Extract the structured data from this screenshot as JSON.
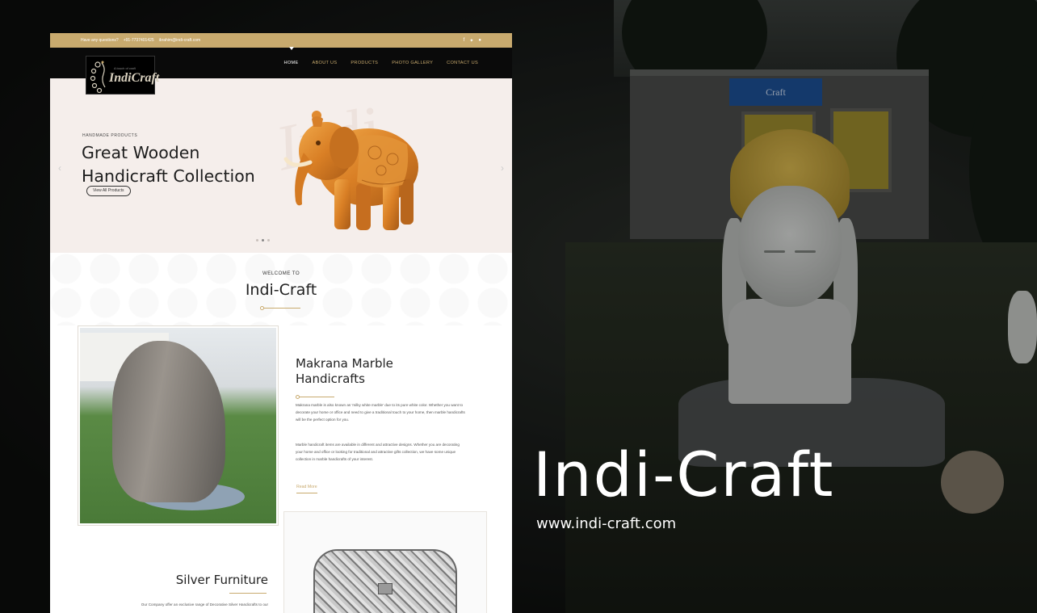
{
  "brand": {
    "title": "Indi-Craft",
    "url": "www.indi-craft.com"
  },
  "background": {
    "sign_text": "Craft"
  },
  "site": {
    "topbar": {
      "question": "Have any questions?",
      "phone": "+91-7737401425",
      "email": "ibrahim@indi-craft.com",
      "social_icons": [
        "facebook-icon",
        "twitter-icon",
        "instagram-icon"
      ]
    },
    "logo": {
      "text": "IndiCraft",
      "sub": "A touch of craft"
    },
    "nav": [
      "HOME",
      "ABOUT US",
      "PRODUCTS",
      "PHOTO GALLERY",
      "CONTACT US"
    ],
    "active_nav": "HOME",
    "hero": {
      "kicker": "HANDMADE PRODUCTS",
      "title_line1": "Great Wooden",
      "title_line2": "Handicraft Collection",
      "button": "View All Products",
      "slide_count": 3,
      "active_slide": 2
    },
    "welcome": {
      "kicker": "WELCOME TO",
      "title": "Indi-Craft"
    },
    "section1": {
      "title_line1": "Makrana Marble",
      "title_line2": "Handicrafts",
      "paragraph1": "Makrana marble is also known as 'milky white marble' due to its pure white color. Whether you want to decorate your home or office and need to give a traditional touch to your home, then marble handicrafts will be the perfect option for you.",
      "paragraph2": "Marble handicraft items are available in different and attractive designs. Whether you are decorating your home and office or looking for traditional and attractive gifts collection, we have some unique collection in marble handicrafts of your interest.",
      "read_more": "Read More"
    },
    "section2": {
      "title": "Silver Furniture",
      "paragraph": "Our Company offer an exclusive range of Decorative Silver Handicrafts to our"
    },
    "colors": {
      "gold": "#c8aa6e",
      "navbar": "#0a0a0a",
      "hero_bg": "#f5eeeb"
    }
  }
}
